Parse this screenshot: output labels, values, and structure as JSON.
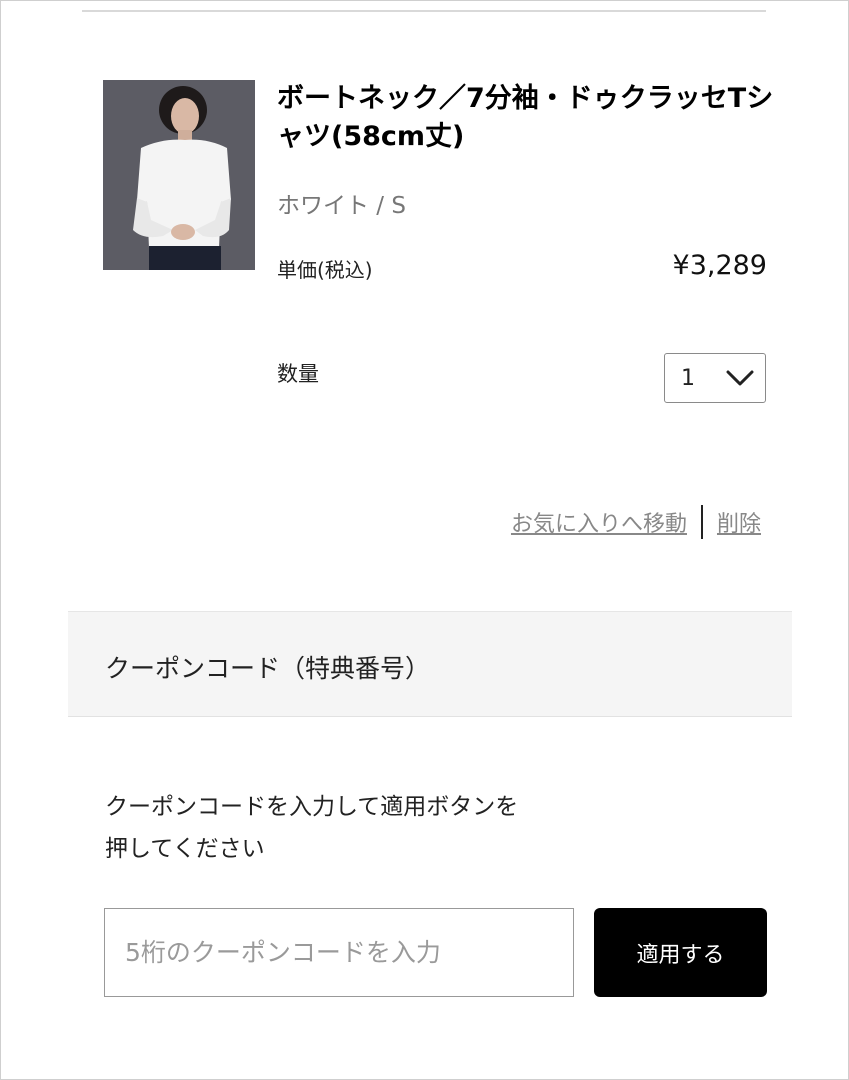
{
  "product": {
    "name": "ボートネック／7分袖・ドゥクラッセTシャツ(58cm丈)",
    "variant": "ホワイト / S",
    "unit_price_label": "単価(税込)",
    "unit_price": "¥3,289",
    "quantity_label": "数量",
    "quantity_value": "1",
    "image_icon": "product-photo"
  },
  "actions": {
    "move_to_favorites": "お気に入りへ移動",
    "delete": "削除"
  },
  "coupon": {
    "title": "クーポンコード（特典番号）",
    "instructions_line1": "クーポンコードを入力して適用ボタンを",
    "instructions_line2": "押してください",
    "input_placeholder": "5桁のクーポンコードを入力",
    "input_value": "",
    "apply_label": "適用する"
  },
  "colors": {
    "section_bg": "#f5f5f5",
    "button_bg": "#000000",
    "link_color": "#888888"
  }
}
